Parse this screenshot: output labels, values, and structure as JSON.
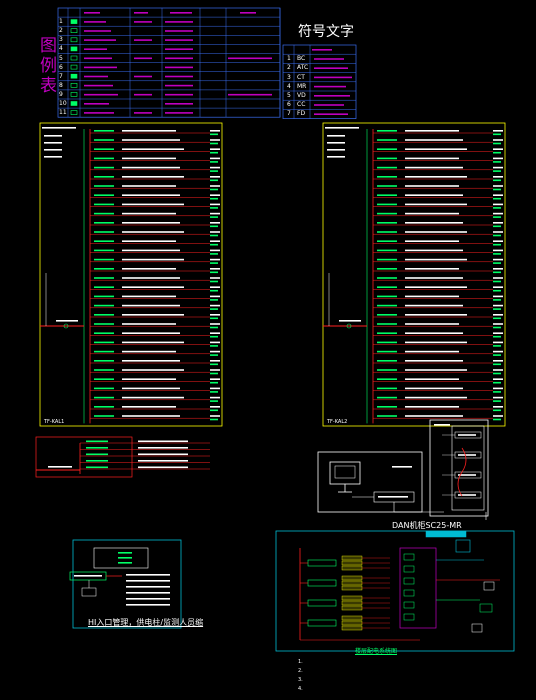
{
  "legend": {
    "title_chars": [
      "图",
      "例",
      "表"
    ],
    "row_numbers": [
      "1",
      "2",
      "3",
      "4",
      "5",
      "6",
      "7",
      "8",
      "9",
      "10",
      "11"
    ]
  },
  "symbol_table": {
    "title": "符号文字",
    "row_numbers": [
      "1",
      "2",
      "3",
      "4",
      "5",
      "6",
      "7"
    ],
    "codes": [
      "BC",
      "ATC",
      "CT",
      "MR",
      "VD",
      "CC",
      "FD"
    ]
  },
  "panel_labels": {
    "left": "TF-KAL1",
    "right": "TF-KAL2"
  },
  "dan_label": "DAN机柜SC25-MR",
  "captions": {
    "bottom_left": "HI入口管理，供电柱/监测人员缩",
    "bottom_right": "楼层配电系统图"
  },
  "notes": [
    "1. ",
    "2. ",
    "3. ",
    "4. "
  ],
  "colors": {
    "background": "#000000",
    "panel_border": "#ffff00",
    "legend_grid": "#3a6df0",
    "circuit_text": "#ffffff",
    "breaker": "#00ff66",
    "feed_line": "#ff2020",
    "title_magenta": "#c000c0"
  }
}
